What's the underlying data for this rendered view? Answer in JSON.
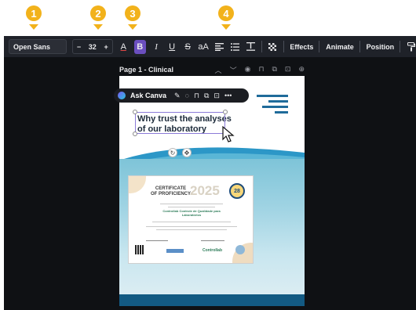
{
  "steps": [
    "1",
    "2",
    "3",
    "4"
  ],
  "toolbar": {
    "font_family": "Open Sans",
    "size_minus": "−",
    "font_size": "32",
    "size_plus": "+",
    "text_color_label": "A",
    "bold_label": "B",
    "italic_label": "I",
    "underline_label": "U",
    "strikethrough_label": "S",
    "case_label": "aA",
    "effects_label": "Effects",
    "animate_label": "Animate",
    "position_label": "Position"
  },
  "page": {
    "title": "Page 1 - Clinical",
    "heading_line1": "Why trust the analyses",
    "heading_line2": "of our laboratory"
  },
  "float_bar": {
    "ask_label": "Ask Canva",
    "more_label": "•••"
  },
  "certificate": {
    "title_line1": "CERTIFICATE",
    "title_line2": "OF PROFICIENCY",
    "year": "2025",
    "badge": "28",
    "org_line1": "Controllab Controle de Qualidade para",
    "org_line2": "Laboratórios",
    "logo_text": "Controllab"
  },
  "colors": {
    "accent_step": "#f2b21b",
    "toolbar_bg": "#1f2229",
    "bold_active": "#6b4fbf",
    "brand_blue": "#135a83"
  }
}
